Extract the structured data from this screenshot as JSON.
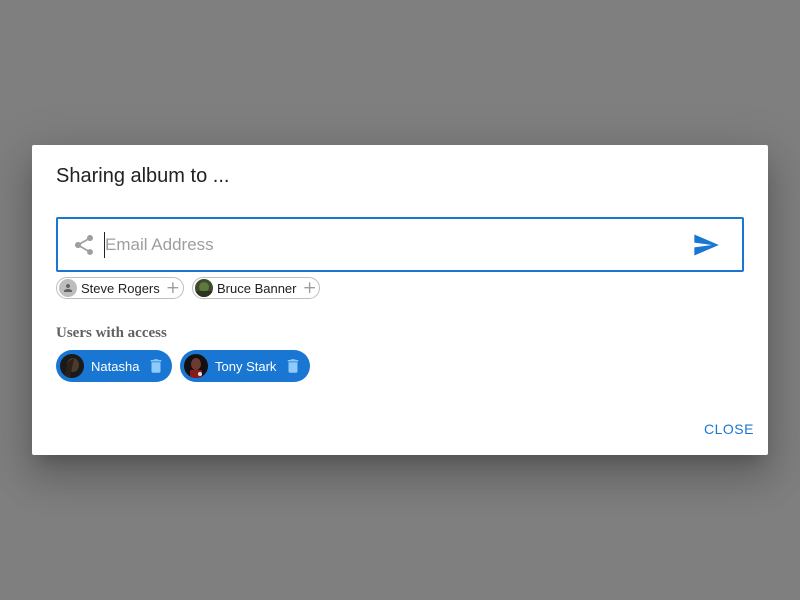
{
  "dialog": {
    "title": "Sharing album to ...",
    "email_placeholder": "Email Address",
    "email_value": "",
    "suggestions": [
      {
        "label": "Steve Rogers",
        "avatar": "person-icon",
        "action_icon": "add-icon",
        "action_symbol": "+"
      },
      {
        "label": "Bruce Banner",
        "avatar": "photo-avatar",
        "action_icon": "add-icon",
        "action_symbol": "+"
      }
    ],
    "access_section_label": "Users with access",
    "users_with_access": [
      {
        "label": "Natasha",
        "avatar": "photo-avatar",
        "action_icon": "trash-icon"
      },
      {
        "label": "Tony Stark",
        "avatar": "photo-avatar",
        "action_icon": "trash-icon"
      }
    ],
    "close_label": "CLOSE"
  },
  "colors": {
    "overlay": "#7f7f7f",
    "accent": "#1976d2",
    "dialog_bg": "#ffffff",
    "chip_border": "#bdbdbd",
    "muted_icon": "#9e9e9e"
  }
}
